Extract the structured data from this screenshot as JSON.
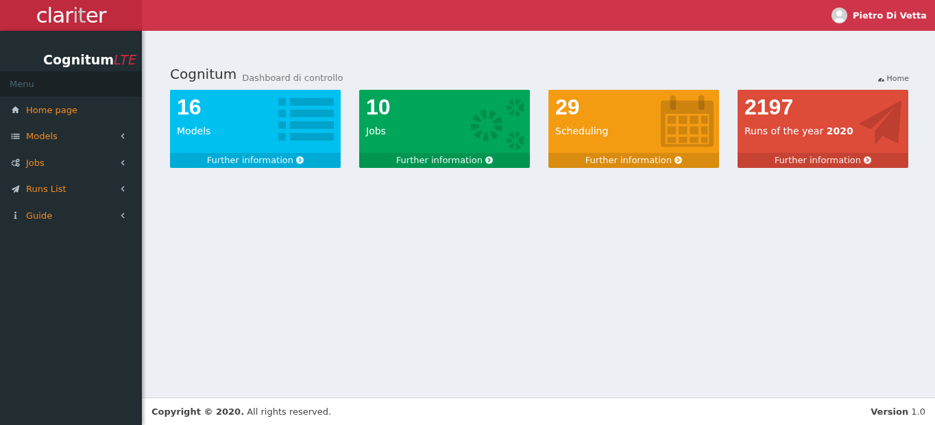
{
  "logo": {
    "parts": [
      {
        "text": "clar",
        "accent": false
      },
      {
        "text": "it",
        "accent": true
      },
      {
        "text": "er",
        "accent": false
      }
    ]
  },
  "user": {
    "name": "Pietro Di Vetta"
  },
  "sidebar": {
    "brand": {
      "name": "Cognitum",
      "suffix": "LTE"
    },
    "header": "Menu",
    "items": [
      {
        "label": "Home page",
        "has_submenu": false
      },
      {
        "label": "Models",
        "has_submenu": true
      },
      {
        "label": "Jobs",
        "has_submenu": true
      },
      {
        "label": "Runs List",
        "has_submenu": true
      },
      {
        "label": "Guide",
        "has_submenu": true
      }
    ]
  },
  "page": {
    "title": "Cognitum",
    "subtitle": "Dashboard di controllo",
    "breadcrumb": "Home"
  },
  "cards": [
    {
      "value": "16",
      "label": "Models",
      "link": "Further information",
      "color": "#00c0ef"
    },
    {
      "value": "10",
      "label": "Jobs",
      "link": "Further information",
      "color": "#00a65a"
    },
    {
      "value": "29",
      "label": "Scheduling",
      "link": "Further information",
      "color": "#f39c12"
    },
    {
      "value": "2197",
      "label": "Runs of the year **2020**",
      "link": "Further information",
      "color": "#dd4b39"
    }
  ],
  "footer": {
    "copyright": "**Copyright © 2020.** All rights reserved.",
    "version": "**Version** 1.0"
  }
}
